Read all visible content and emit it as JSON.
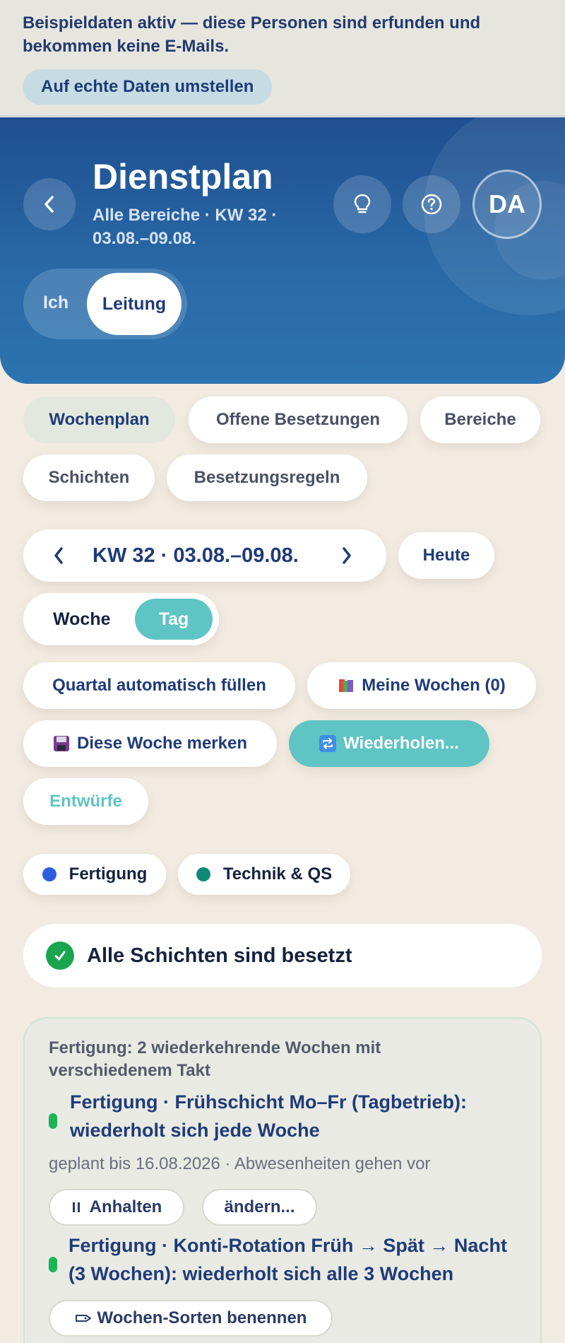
{
  "banner": {
    "text": "Beispieldaten aktiv — diese Personen sind erfunden und bekommen keine E-Mails.",
    "button_label": "Auf echte Daten umstellen"
  },
  "header": {
    "title": "Dienstplan",
    "subtitle": "Alle Bereiche · KW 32 · 03.08.–09.08.",
    "avatar_initials": "DA",
    "role_options": [
      "Ich",
      "Leitung"
    ],
    "role_selected": "Leitung"
  },
  "tabs": [
    {
      "label": "Wochenplan",
      "active": true
    },
    {
      "label": "Offene Besetzungen",
      "active": false
    },
    {
      "label": "Bereiche",
      "active": false
    },
    {
      "label": "Schichten",
      "active": false
    },
    {
      "label": "Besetzungsregeln",
      "active": false
    }
  ],
  "week_nav": {
    "label": "KW 32 · 03.08.–09.08.",
    "today_label": "Heute"
  },
  "view_toggle": {
    "options": [
      "Woche",
      "Tag"
    ],
    "selected": "Tag"
  },
  "actions": {
    "fill_quarter": "Quartal automatisch füllen",
    "my_weeks": "Meine Wochen (0)",
    "remember_week": "Diese Woche merken",
    "repeat": "Wiederholen...",
    "drafts": "Entwürfe"
  },
  "areas": [
    {
      "label": "Fertigung",
      "color": "#2b5fe0"
    },
    {
      "label": "Technik & QS",
      "color": "#0f8a7a"
    }
  ],
  "status": {
    "text": "Alle Schichten sind besetzt"
  },
  "recurring_card": {
    "title": "Fertigung: 2 wiederkehrende Wochen mit verschiedenem Takt",
    "rules": [
      {
        "text": "Fertigung · Frühschicht Mo–Fr (Tagbetrieb): wiederholt sich jede Woche",
        "meta": "geplant bis 16.08.2026 · Abwesenheiten gehen vor",
        "pause_label": "Anhalten",
        "edit_label": "ändern..."
      },
      {
        "text": "Fertigung · Konti-Rotation Früh → Spät → Nacht (3 Wochen): wiederholt sich alle 3 Wochen",
        "name_label": "Wochen-Sorten benennen"
      }
    ]
  },
  "colors": {
    "accent_teal": "#5ec4c4",
    "header_blue": "#2a6aa8",
    "success_green": "#1aa44f"
  }
}
